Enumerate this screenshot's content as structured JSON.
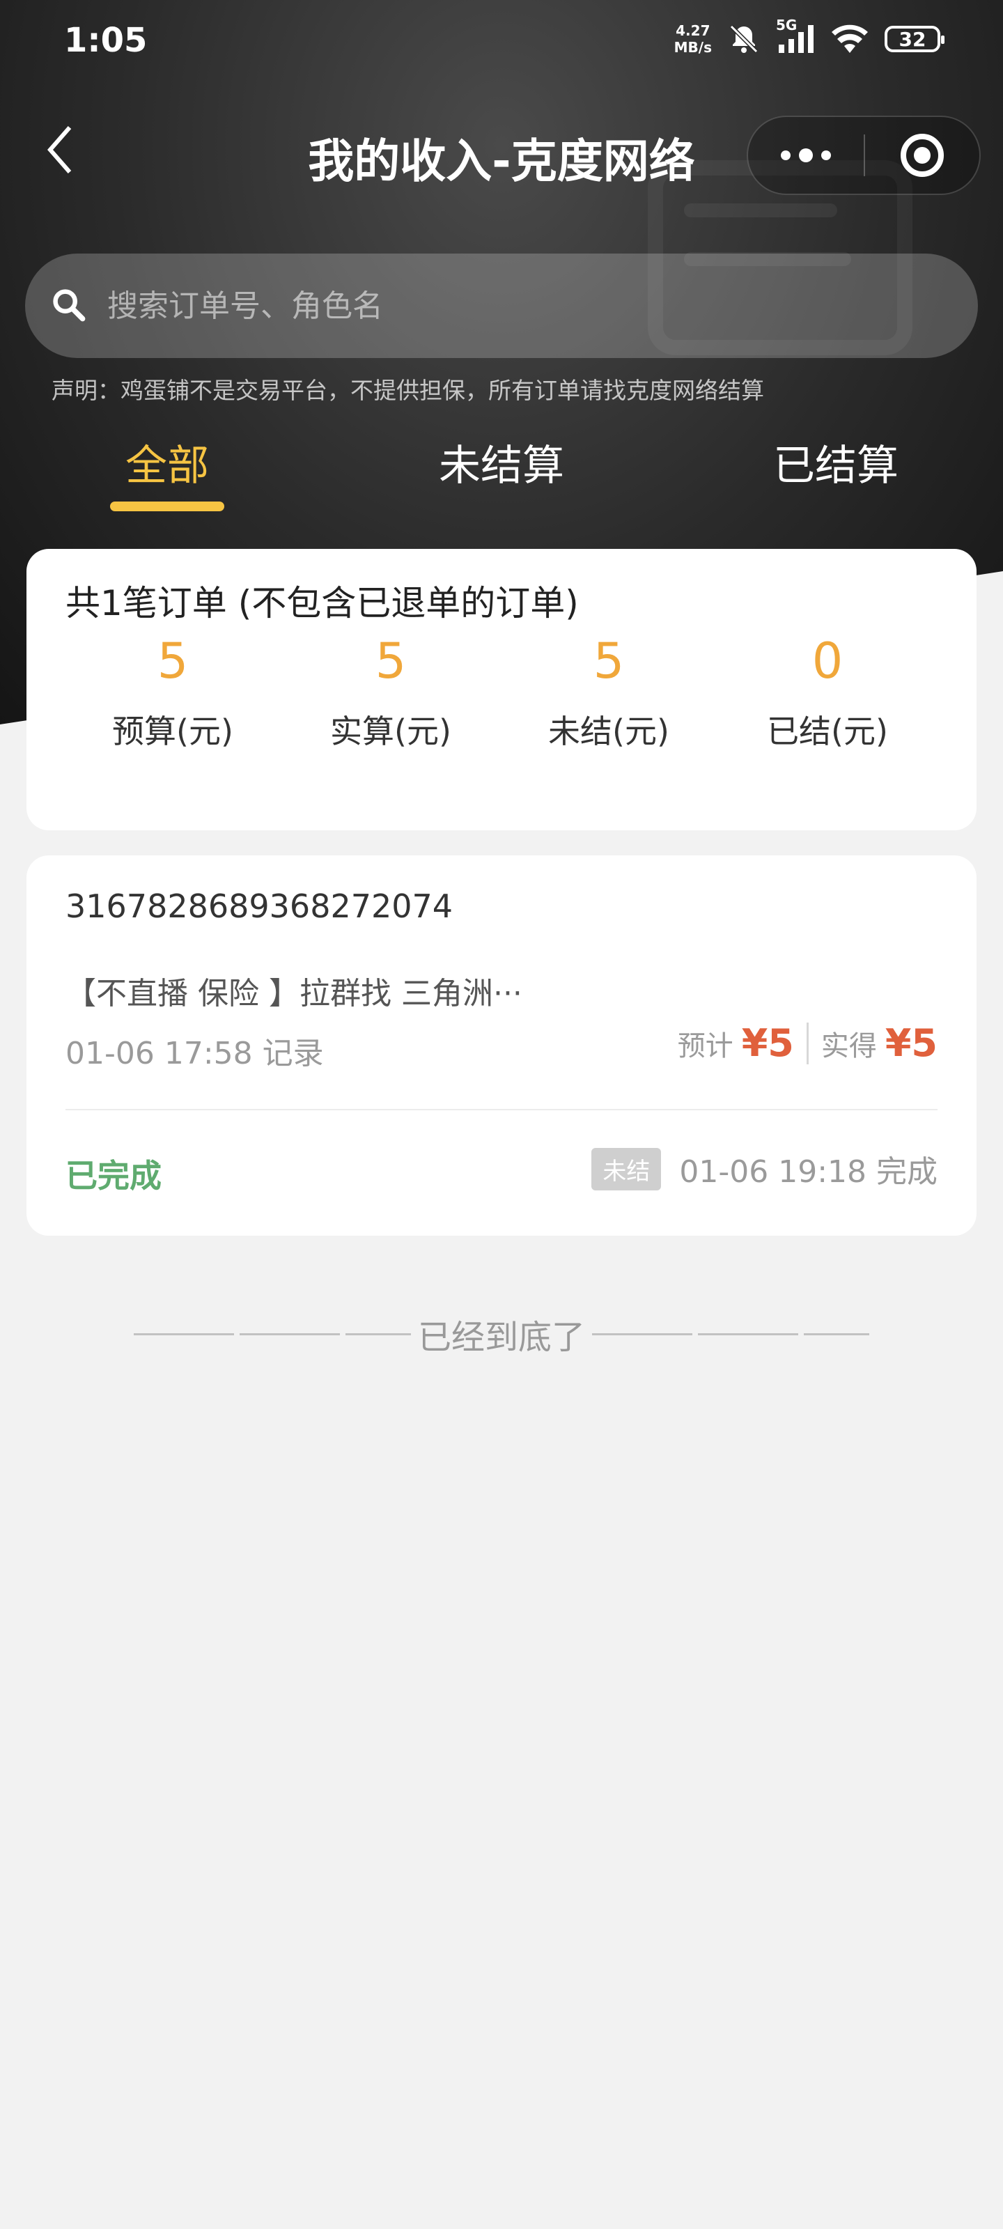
{
  "status_bar": {
    "time": "1:05",
    "net_speed_value": "4.27",
    "net_speed_unit": "MB/s",
    "network": "5G",
    "battery": "32"
  },
  "nav": {
    "title": "我的收入-克度网络"
  },
  "search": {
    "placeholder": "搜索订单号、角色名"
  },
  "notice": "声明：鸡蛋铺不是交易平台，不提供担保，所有订单请找克度网络结算",
  "tabs": [
    {
      "label": "全部",
      "active": true
    },
    {
      "label": "未结算",
      "active": false
    },
    {
      "label": "已结算",
      "active": false
    }
  ],
  "summary": {
    "title": "共1笔订单 (不包含已退单的订单)",
    "stats": [
      {
        "value": "5",
        "label": "预算(元)"
      },
      {
        "value": "5",
        "label": "实算(元)"
      },
      {
        "value": "5",
        "label": "未结(元)"
      },
      {
        "value": "0",
        "label": "已结(元)"
      }
    ]
  },
  "order": {
    "order_no": "3167828689368272074",
    "name": "【不直播 保险 】拉群找 三角洲···",
    "record_time": "01-06 17:58 记录",
    "expected_label": "预计",
    "expected_value": "¥5",
    "actual_label": "实得",
    "actual_value": "¥5",
    "status": "已完成",
    "settle_badge": "未结",
    "finish_time": "01-06 19:18 完成"
  },
  "footer": {
    "end_text": "已经到底了"
  },
  "colors": {
    "accent_yellow": "#f6c443",
    "stat_orange": "#f0a73a",
    "amount_red": "#e0603c",
    "status_green": "#5fab6f",
    "page_bg": "#f2f2f2"
  }
}
